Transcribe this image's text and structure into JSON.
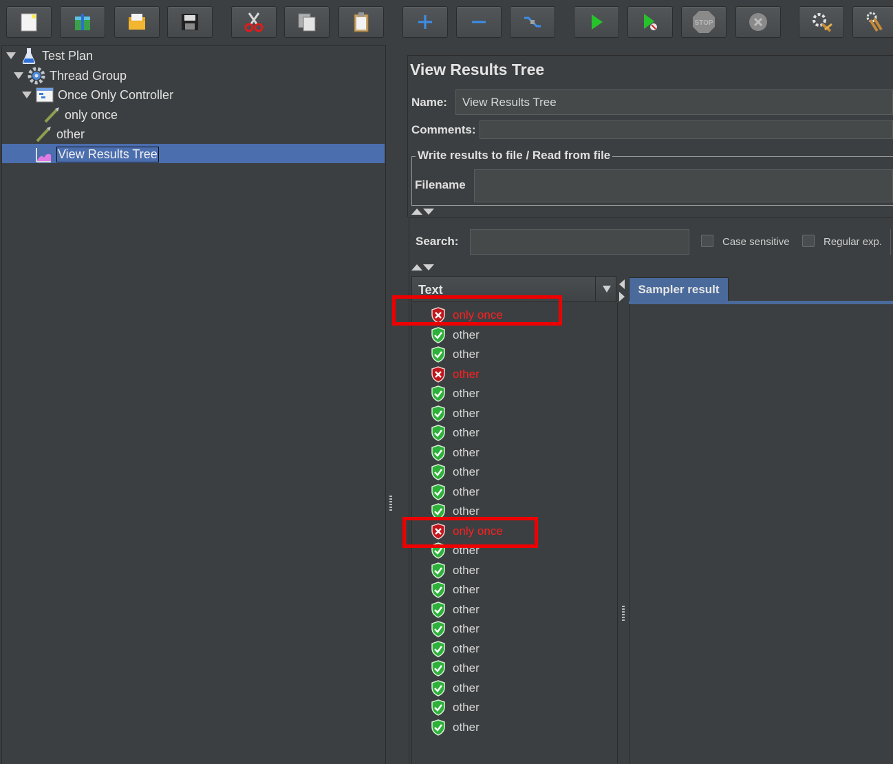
{
  "toolbar": {
    "buttons": [
      {
        "name": "new-icon"
      },
      {
        "name": "templates-icon"
      },
      {
        "name": "open-icon"
      },
      {
        "name": "save-icon"
      },
      {
        "name": "cut-icon"
      },
      {
        "name": "copy-icon"
      },
      {
        "name": "paste-icon"
      },
      {
        "name": "expand-icon"
      },
      {
        "name": "collapse-icon"
      },
      {
        "name": "toggle-icon"
      },
      {
        "name": "start-icon"
      },
      {
        "name": "start-no-pauses-icon"
      },
      {
        "name": "stop-icon"
      },
      {
        "name": "shutdown-icon"
      },
      {
        "name": "clear-icon"
      },
      {
        "name": "clear-all-icon"
      }
    ]
  },
  "tree": {
    "items": [
      {
        "label": "Test Plan"
      },
      {
        "label": "Thread Group"
      },
      {
        "label": "Once Only Controller"
      },
      {
        "label": "only once"
      },
      {
        "label": "other"
      },
      {
        "label": "View Results Tree"
      }
    ]
  },
  "panel": {
    "title": "View Results Tree",
    "name_label": "Name:",
    "name_value": "View Results Tree",
    "comments_label": "Comments:",
    "fieldset_legend": "Write results to file / Read from file",
    "filename_label": "Filename",
    "search_label": "Search:",
    "case_sensitive_label": "Case sensitive",
    "regex_label": "Regular exp."
  },
  "results": {
    "column_header": "Text",
    "rows": [
      {
        "label": "only once",
        "status": "error"
      },
      {
        "label": "other",
        "status": "success"
      },
      {
        "label": "other",
        "status": "success"
      },
      {
        "label": "other",
        "status": "error"
      },
      {
        "label": "other",
        "status": "success"
      },
      {
        "label": "other",
        "status": "success"
      },
      {
        "label": "other",
        "status": "success"
      },
      {
        "label": "other",
        "status": "success"
      },
      {
        "label": "other",
        "status": "success"
      },
      {
        "label": "other",
        "status": "success"
      },
      {
        "label": "other",
        "status": "success"
      },
      {
        "label": "only once",
        "status": "error"
      },
      {
        "label": "other",
        "status": "success"
      },
      {
        "label": "other",
        "status": "success"
      },
      {
        "label": "other",
        "status": "success"
      },
      {
        "label": "other",
        "status": "success"
      },
      {
        "label": "other",
        "status": "success"
      },
      {
        "label": "other",
        "status": "success"
      },
      {
        "label": "other",
        "status": "success"
      },
      {
        "label": "other",
        "status": "success"
      },
      {
        "label": "other",
        "status": "success"
      },
      {
        "label": "other",
        "status": "success"
      }
    ]
  },
  "tabs": {
    "sampler_result": "Sampler result"
  },
  "colors": {
    "background": "#3c3f41",
    "selection": "#4b6eaf",
    "error_text": "#ff2020",
    "highlight_box": "#ee0000"
  }
}
